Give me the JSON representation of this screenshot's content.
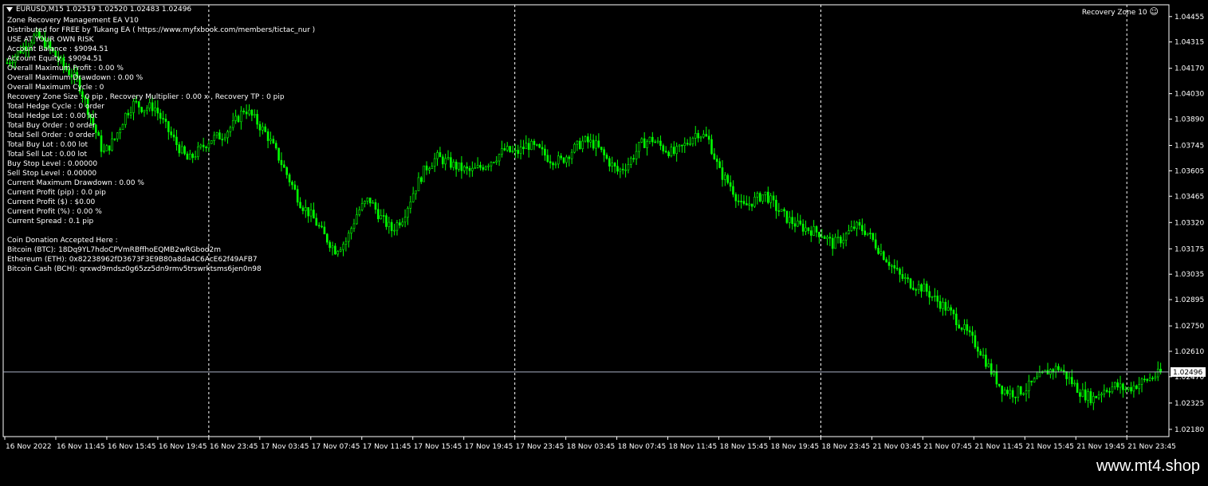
{
  "chart": {
    "symbol_line": "EURUSD,M15  1.02519 1.02520 1.02483 1.02496",
    "indicator_label": "Recovery Zone 10",
    "smiley": "☺",
    "current_price": "1.02496",
    "colors": {
      "background": "#000000",
      "candles": "#00ff00",
      "grid": "#ffffff",
      "price_line": "#a9b0c4",
      "text": "#ffffff"
    }
  },
  "info_lines": [
    "Zone Recovery Management EA V10",
    "Distributed for FREE by Tukang EA ( https://www.myfxbook.com/members/tictac_nur )",
    "USE AT YOUR OWN RISK",
    "Account Balance : $9094.51",
    "Account Equity : $9094.51",
    "Overall Maximum Profit : 0.00 %",
    "Overall Maximum Drawdown : 0.00 %",
    "Overall Maximum Cycle    : 0",
    "Recovery Zone Size : 0 pip , Recovery Multiplier : 0.00 x , Recovery TP : 0 pip",
    "Total Hedge Cycle : 0 order",
    "Total Hedge Lot   : 0.00 lot",
    "Total Buy Order   : 0 order",
    "Total Sell Order : 0 order",
    "Total Buy Lot    : 0.00 lot",
    "Total Sell Lot   : 0.00 lot",
    "Buy Stop Level : 0.00000",
    "Sell Stop Level : 0.00000",
    "Current Maximum Drawdown : 0.00 %",
    "Current Profit (pip)  : 0.0 pip",
    "Current Profit ($) : $0.00",
    "Current Profit (%) : 0.00 %",
    "Current Spread  : 0.1 pip",
    "",
    "Coin Donation Accepted Here :",
    "Bitcoin (BTC): 18Dq9YL7hdoCPVmRBffhoEQMB2wRGbod2m",
    "Ethereum (ETH): 0x82238962fD3673F3E9B80a8da4C6AcE62f49AFB7",
    "Bitcoin Cash (BCH): qrxwd9mdsz0g65zz5dn9rmv5trswrktsms6jen0n98"
  ],
  "watermark": "www.mt4.shop",
  "chart_data": {
    "type": "candlestick",
    "title": "EURUSD,M15",
    "ylim": [
      1.0214,
      1.0452
    ],
    "y_ticks": [
      "1.04455",
      "1.04315",
      "1.04170",
      "1.04030",
      "1.03890",
      "1.03745",
      "1.03605",
      "1.03465",
      "1.03320",
      "1.03175",
      "1.03035",
      "1.02895",
      "1.02750",
      "1.02610",
      "1.02470",
      "1.02325",
      "1.02180"
    ],
    "x_ticks": [
      "16 Nov 2022",
      "16 Nov 11:45",
      "16 Nov 15:45",
      "16 Nov 19:45",
      "16 Nov 23:45",
      "17 Nov 03:45",
      "17 Nov 07:45",
      "17 Nov 11:45",
      "17 Nov 15:45",
      "17 Nov 19:45",
      "17 Nov 23:45",
      "18 Nov 03:45",
      "18 Nov 07:45",
      "18 Nov 11:45",
      "18 Nov 15:45",
      "18 Nov 19:45",
      "18 Nov 23:45",
      "21 Nov 03:45",
      "21 Nov 07:45",
      "21 Nov 11:45",
      "21 Nov 15:45",
      "21 Nov 19:45",
      "21 Nov 23:45"
    ],
    "day_separators_at_ticks": [
      4,
      10,
      16,
      22
    ],
    "last_price": 1.02496,
    "close_path": [
      [
        0,
        1.042
      ],
      [
        10,
        1.0435
      ],
      [
        14,
        1.043
      ],
      [
        20,
        1.0418
      ],
      [
        25,
        1.041
      ],
      [
        30,
        1.0388
      ],
      [
        34,
        1.037
      ],
      [
        38,
        1.0378
      ],
      [
        42,
        1.0392
      ],
      [
        45,
        1.0398
      ],
      [
        48,
        1.0395
      ],
      [
        52,
        1.0396
      ],
      [
        56,
        1.0385
      ],
      [
        60,
        1.0375
      ],
      [
        64,
        1.0366
      ],
      [
        68,
        1.0372
      ],
      [
        72,
        1.0378
      ],
      [
        76,
        1.038
      ],
      [
        80,
        1.0386
      ],
      [
        84,
        1.0395
      ],
      [
        88,
        1.0388
      ],
      [
        92,
        1.038
      ],
      [
        96,
        1.0368
      ],
      [
        100,
        1.0355
      ],
      [
        104,
        1.0342
      ],
      [
        108,
        1.0335
      ],
      [
        112,
        1.0325
      ],
      [
        116,
        1.0317
      ],
      [
        120,
        1.0322
      ],
      [
        124,
        1.0338
      ],
      [
        128,
        1.0345
      ],
      [
        132,
        1.0335
      ],
      [
        136,
        1.0328
      ],
      [
        140,
        1.0335
      ],
      [
        144,
        1.035
      ],
      [
        148,
        1.0362
      ],
      [
        152,
        1.0368
      ],
      [
        156,
        1.0365
      ],
      [
        160,
        1.0362
      ],
      [
        164,
        1.036
      ],
      [
        168,
        1.0363
      ],
      [
        172,
        1.0367
      ],
      [
        176,
        1.0372
      ],
      [
        180,
        1.037
      ],
      [
        184,
        1.0375
      ],
      [
        188,
        1.0372
      ],
      [
        192,
        1.0367
      ],
      [
        196,
        1.0366
      ],
      [
        200,
        1.0372
      ],
      [
        204,
        1.0377
      ],
      [
        208,
        1.0375
      ],
      [
        212,
        1.0367
      ],
      [
        216,
        1.036
      ],
      [
        220,
        1.0365
      ],
      [
        224,
        1.0375
      ],
      [
        228,
        1.0378
      ],
      [
        232,
        1.0373
      ],
      [
        236,
        1.037
      ],
      [
        240,
        1.0375
      ],
      [
        244,
        1.0382
      ],
      [
        248,
        1.0378
      ],
      [
        252,
        1.036
      ],
      [
        256,
        1.0352
      ],
      [
        260,
        1.034
      ],
      [
        264,
        1.0344
      ],
      [
        268,
        1.0348
      ],
      [
        272,
        1.034
      ],
      [
        276,
        1.0334
      ],
      [
        280,
        1.033
      ],
      [
        284,
        1.0328
      ],
      [
        288,
        1.0326
      ],
      [
        292,
        1.032
      ],
      [
        296,
        1.0324
      ],
      [
        300,
        1.033
      ],
      [
        304,
        1.0327
      ],
      [
        308,
        1.0318
      ],
      [
        312,
        1.031
      ],
      [
        316,
        1.0302
      ],
      [
        320,
        1.0298
      ],
      [
        324,
        1.0296
      ],
      [
        328,
        1.029
      ],
      [
        332,
        1.0285
      ],
      [
        336,
        1.0278
      ],
      [
        340,
        1.027
      ],
      [
        344,
        1.0262
      ],
      [
        348,
        1.025
      ],
      [
        352,
        1.024
      ],
      [
        356,
        1.0238
      ],
      [
        360,
        1.024
      ],
      [
        364,
        1.0245
      ],
      [
        368,
        1.025
      ],
      [
        372,
        1.0252
      ],
      [
        376,
        1.0245
      ],
      [
        380,
        1.0238
      ],
      [
        384,
        1.0235
      ],
      [
        388,
        1.024
      ],
      [
        392,
        1.0242
      ],
      [
        396,
        1.024
      ],
      [
        400,
        1.0243
      ],
      [
        404,
        1.0246
      ],
      [
        408,
        1.0249
      ]
    ]
  }
}
